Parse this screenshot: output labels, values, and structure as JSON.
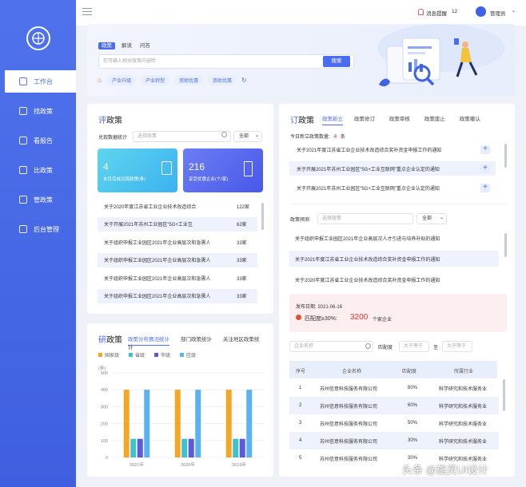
{
  "sidebar": {
    "items": [
      {
        "label": "工作台",
        "active": true
      },
      {
        "label": "找政策"
      },
      {
        "label": "看报告"
      },
      {
        "label": "比政策"
      },
      {
        "label": "管政策"
      },
      {
        "label": "后台管理"
      }
    ]
  },
  "topbar": {
    "notice_label": "消息提醒",
    "notice_count": "12",
    "user": "管理员"
  },
  "hero": {
    "tabs": [
      "政策",
      "解读",
      "问答"
    ],
    "placeholder": "您可输入相关政策内容哈",
    "search_label": "搜索",
    "hot": [
      "产业升级",
      "产业转型",
      "资助优惠",
      "资助优惠"
    ]
  },
  "ping": {
    "title_a": "评",
    "title_b": "政策",
    "filter_label": "兑现数据统计",
    "filter_ph": "选择政策",
    "filter_sel": "全部",
    "stat1": {
      "value": "4",
      "label": "本月完成兑现政策(条)"
    },
    "stat2": {
      "value": "216",
      "label": "享受优惠企业(个/家)"
    },
    "rows": [
      {
        "t": "关于2020年度江苏省工业企业技术改造综合",
        "v": "122家"
      },
      {
        "t": "关于开展2021年苏州工业园区“5G+工业互",
        "v": "62家"
      },
      {
        "t": "关于组织申报工业园区2021年企业高层次和急需人",
        "v": "33家"
      },
      {
        "t": "关于组织申报工业园区2021年企业高层次和急需人",
        "v": "33家"
      },
      {
        "t": "关于组织申报工业园区2021年企业高层次和急需人",
        "v": "33家"
      },
      {
        "t": "关于组织申报工业园区2021年企业高层次和急需人",
        "v": "33家"
      }
    ]
  },
  "yan": {
    "title_a": "研",
    "title_b": "政策",
    "tabs": [
      "政策分布情况统计",
      "部门政策统计",
      "关注地区政策统计"
    ]
  },
  "chart_data": {
    "type": "bar",
    "categories": [
      "2021年",
      "2020年",
      "2019年"
    ],
    "series": [
      {
        "name": "国家级",
        "values": [
          400,
          400,
          400
        ],
        "color": "#f5a623"
      },
      {
        "name": "省级",
        "values": [
          110,
          110,
          110
        ],
        "color": "#3fc1c9"
      },
      {
        "name": "市级",
        "values": [
          110,
          110,
          110
        ],
        "color": "#5b5bd6"
      },
      {
        "name": "区级",
        "values": [
          400,
          400,
          400
        ],
        "color": "#5ab3f0"
      }
    ],
    "yticks": [
      "0",
      "100",
      "200",
      "300",
      "400",
      "500"
    ],
    "ylabel": "(条)",
    "ylim": [
      0,
      500
    ]
  },
  "ding": {
    "title_a": "订",
    "title_b": "政策",
    "tabs": [
      "政策新立",
      "政策修订",
      "政策审核",
      "政策废止",
      "政策撤认"
    ],
    "today_label": "今日新立政策数量:",
    "today_count": "4",
    "today_unit": "条",
    "new_rows": [
      "关于2021年度江苏省工业企业技术改造综合奖补资金申报工作的通知",
      "关于开展2021年苏州工业园区“5G+工业互联网”重点企业认定的通知",
      "关于开展2021年苏州工业园区“5G+工业互联网”重点企业认定的通知"
    ],
    "predict_label": "政策预测",
    "predict_ph": "选择政策",
    "predict_sel": "全部",
    "pred_rows": [
      "关于组织申报工业园区2021年企业高层次人才引进与培养补贴的通知",
      "关于2021年度江苏省工业企业技术改造综合奖补资金申报工作的通知",
      "关于2020年度江苏省工业企业技术改造综合奖补资金申报工作的通知"
    ],
    "publish": "发布日期:  2021-06-16",
    "match_label": "匹配度≥30%:",
    "match_count": "3200",
    "match_unit": "个家企业",
    "ent_ph": "企业名称",
    "match_f": "匹配度",
    "gt_ph": "大于等于",
    "to": "至",
    "gt_ph2": "大于等于",
    "headers": [
      "序号",
      "企业名称",
      "匹配度",
      "所属行业"
    ],
    "table": [
      [
        "1",
        "苏州信意科技服务有限公司",
        "80%",
        "科学研究和技术服务业"
      ],
      [
        "2",
        "苏州信意科技服务有限公司",
        "60%",
        "科学研究和技术服务业"
      ],
      [
        "3",
        "苏州信意科技服务有限公司",
        "50%",
        "科学研究和技术服务业"
      ],
      [
        "4",
        "苏州信意科技服务有限公司",
        "30%",
        "科学研究和技术服务业"
      ],
      [
        "5",
        "苏州信意科技服务有限公司",
        "30%",
        "科学研究和技术服务业"
      ]
    ]
  },
  "watermark": "头条 @施灵UI设计"
}
